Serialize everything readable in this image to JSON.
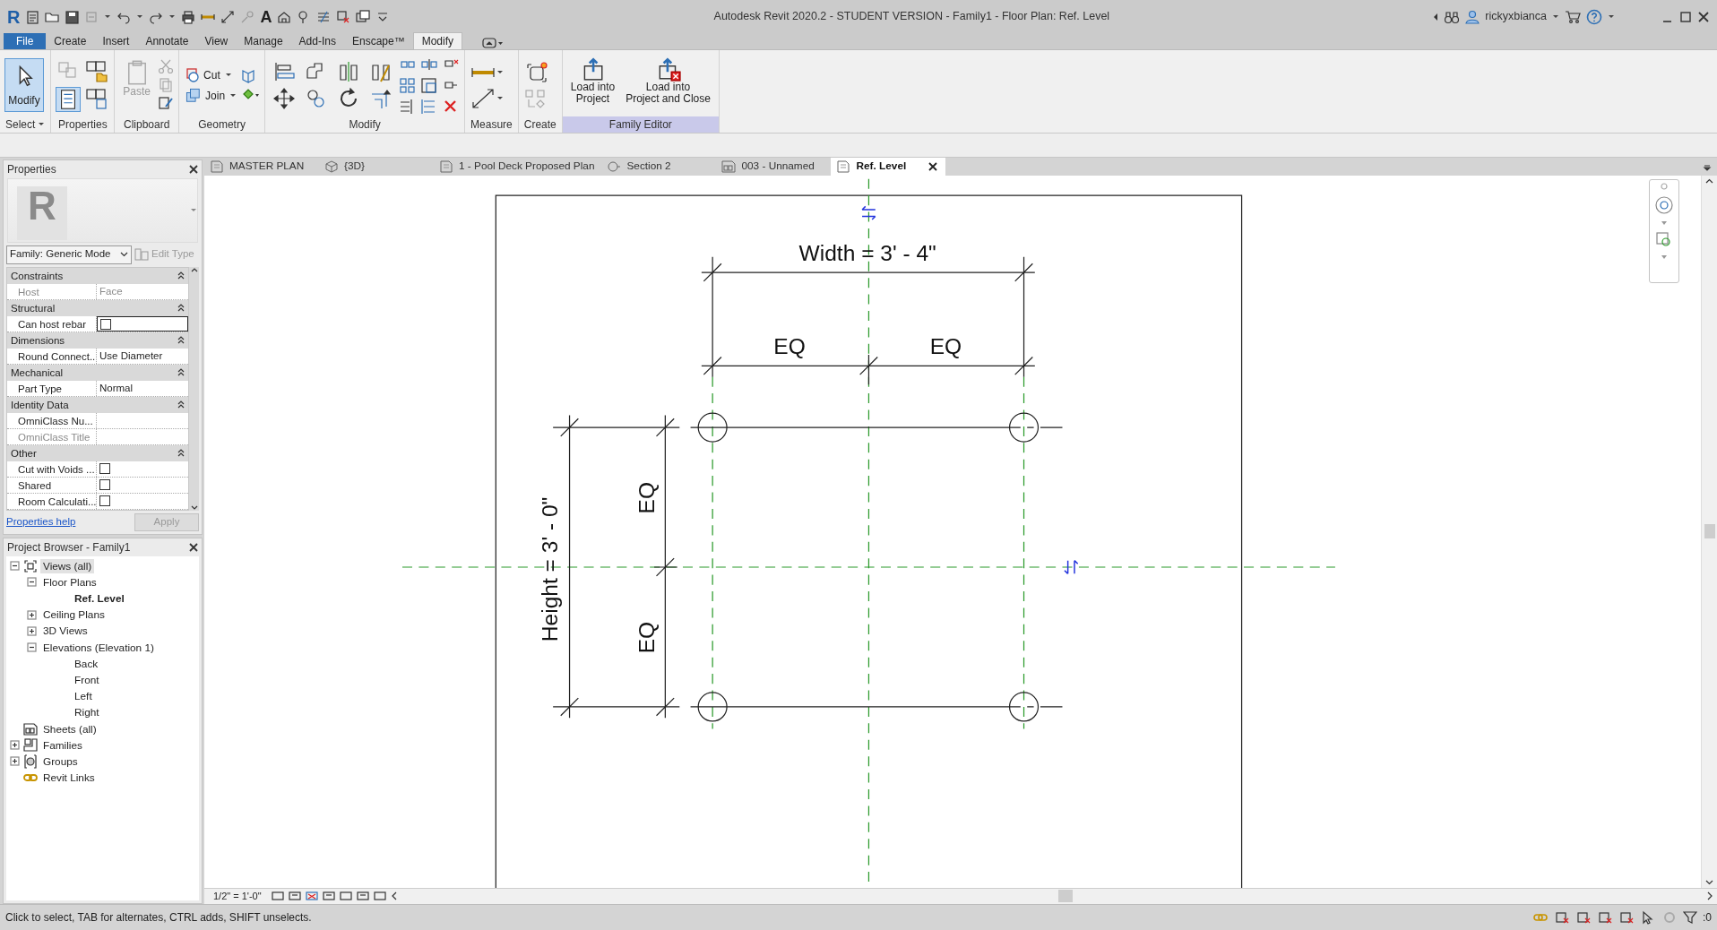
{
  "title_bar": {
    "app_logo": "R",
    "text_tool_glyph": "A",
    "title": "Autodesk Revit 2020.2 - STUDENT VERSION - Family1 - Floor Plan: Ref. Level",
    "user": "rickyxbianca"
  },
  "ribbon": {
    "tabs": [
      {
        "label": "File",
        "kind": "file",
        "selected": false
      },
      {
        "label": "Create",
        "kind": "tab",
        "selected": false
      },
      {
        "label": "Insert",
        "kind": "tab",
        "selected": false
      },
      {
        "label": "Annotate",
        "kind": "tab",
        "selected": false
      },
      {
        "label": "View",
        "kind": "tab",
        "selected": false
      },
      {
        "label": "Manage",
        "kind": "tab",
        "selected": false
      },
      {
        "label": "Add-Ins",
        "kind": "tab",
        "selected": false
      },
      {
        "label": "Enscape™",
        "kind": "tab",
        "selected": false
      },
      {
        "label": "Modify",
        "kind": "tab",
        "selected": true
      }
    ],
    "panels": [
      {
        "label": "Select",
        "kind": "select",
        "dropdown": true,
        "contextual": false,
        "tools": [
          {
            "lines": [
              "Modify"
            ],
            "selected": true,
            "disabled": false
          }
        ]
      },
      {
        "label": "Properties",
        "kind": "properties",
        "dropdown": false,
        "contextual": false
      },
      {
        "label": "Clipboard",
        "kind": "clipboard",
        "dropdown": false,
        "contextual": false,
        "tools": [
          {
            "lines": [
              "Paste"
            ],
            "selected": false,
            "disabled": true
          }
        ]
      },
      {
        "label": "Geometry",
        "kind": "geometry",
        "dropdown": false,
        "contextual": false,
        "tools": [
          {
            "lines": [
              "Cut"
            ],
            "selected": false,
            "disabled": false
          },
          {
            "lines": [
              "Join"
            ],
            "selected": false,
            "disabled": false
          }
        ]
      },
      {
        "label": "Modify",
        "kind": "modify",
        "dropdown": false,
        "contextual": false
      },
      {
        "label": "Measure",
        "kind": "measure",
        "dropdown": false,
        "contextual": false
      },
      {
        "label": "Create",
        "kind": "create",
        "dropdown": false,
        "contextual": false
      },
      {
        "label": "Family Editor",
        "kind": "family",
        "dropdown": false,
        "contextual": true,
        "tools": [
          {
            "lines": [
              "Load into",
              "Project"
            ],
            "selected": false,
            "disabled": false
          },
          {
            "lines": [
              "Load into",
              "Project and Close"
            ],
            "selected": false,
            "disabled": false
          }
        ]
      }
    ]
  },
  "properties": {
    "title": "Properties",
    "preview": "R",
    "type_selector": "Family: Generic Mode",
    "edit_type": {
      "label": "Edit Type",
      "disabled": true
    },
    "groups": [
      {
        "label": "Constraints",
        "rows": [
          {
            "label": "Host",
            "kind": "text",
            "value": "Face",
            "disabled": true,
            "selected": false
          }
        ]
      },
      {
        "label": "Structural",
        "rows": [
          {
            "label": "Can host rebar",
            "kind": "checkbox",
            "checked": false,
            "disabled": false,
            "selected": true
          }
        ]
      },
      {
        "label": "Dimensions",
        "rows": [
          {
            "label": "Round Connect...",
            "kind": "text",
            "value": "Use Diameter",
            "disabled": false,
            "selected": false
          }
        ]
      },
      {
        "label": "Mechanical",
        "rows": [
          {
            "label": "Part Type",
            "kind": "text",
            "value": "Normal",
            "disabled": false,
            "selected": false
          }
        ]
      },
      {
        "label": "Identity Data",
        "rows": [
          {
            "label": "OmniClass Nu...",
            "kind": "text",
            "disabled": false,
            "selected": false
          },
          {
            "label": "OmniClass Title",
            "kind": "text",
            "disabled": true,
            "selected": false
          }
        ]
      },
      {
        "label": "Other",
        "rows": [
          {
            "label": "Cut with Voids ...",
            "kind": "checkbox",
            "checked": false,
            "disabled": false,
            "selected": false
          },
          {
            "label": "Shared",
            "kind": "checkbox",
            "checked": false,
            "disabled": false,
            "selected": false
          },
          {
            "label": "Room Calculati...",
            "kind": "checkbox",
            "checked": false,
            "disabled": false,
            "selected": false
          }
        ]
      }
    ],
    "help_link": "Properties help",
    "apply": {
      "label": "Apply",
      "disabled": true
    }
  },
  "project_browser": {
    "title": "Project Browser - Family1",
    "tree": [
      {
        "label": "Views (all)",
        "kind": "views",
        "expanded": true,
        "selected": true,
        "current": false,
        "children": [
          {
            "label": "Floor Plans",
            "expanded": true,
            "selected": false,
            "current": false,
            "children": [
              {
                "label": "Ref. Level",
                "selected": false,
                "current": true
              }
            ]
          },
          {
            "label": "Ceiling Plans",
            "expanded": false,
            "selected": false,
            "current": false
          },
          {
            "label": "3D Views",
            "expanded": false,
            "selected": false,
            "current": false
          },
          {
            "label": "Elevations (Elevation 1)",
            "expanded": true,
            "selected": false,
            "current": false,
            "children": [
              {
                "label": "Back",
                "selected": false,
                "current": false
              },
              {
                "label": "Front",
                "selected": false,
                "current": false
              },
              {
                "label": "Left",
                "selected": false,
                "current": false
              },
              {
                "label": "Right",
                "selected": false,
                "current": false
              }
            ]
          }
        ]
      },
      {
        "label": "Sheets (all)",
        "kind": "sheets",
        "selected": false,
        "current": false
      },
      {
        "label": "Families",
        "kind": "families",
        "expanded": false,
        "selected": false,
        "current": false
      },
      {
        "label": "Groups",
        "kind": "groups",
        "expanded": false,
        "selected": false,
        "current": false
      },
      {
        "label": "Revit Links",
        "kind": "links",
        "selected": false,
        "current": false
      }
    ]
  },
  "view_tabs": [
    {
      "label": "MASTER PLAN",
      "kind": "plan",
      "selected": false
    },
    {
      "label": "{3D}",
      "kind": "model",
      "selected": false
    },
    {
      "label": "1 - Pool Deck Proposed Plan",
      "kind": "plan",
      "selected": false
    },
    {
      "label": "Section 2",
      "kind": "section",
      "selected": false
    },
    {
      "label": "003 - Unnamed",
      "kind": "sheet",
      "selected": false
    },
    {
      "label": "Ref. Level",
      "kind": "plan",
      "selected": true
    }
  ],
  "canvas": {
    "width_dimension": "Width = 3' - 4\"",
    "height_dimension": "Height = 3' - 0\"",
    "eq_labels": [
      "EQ",
      "EQ",
      "EQ",
      "EQ"
    ]
  },
  "view_control_bar": {
    "scale": "1/2\" = 1'-0\""
  },
  "status_bar": {
    "message": "Click to select, TAB for alternates, CTRL adds, SHIFT unselects.",
    "filter_count": ":0"
  }
}
